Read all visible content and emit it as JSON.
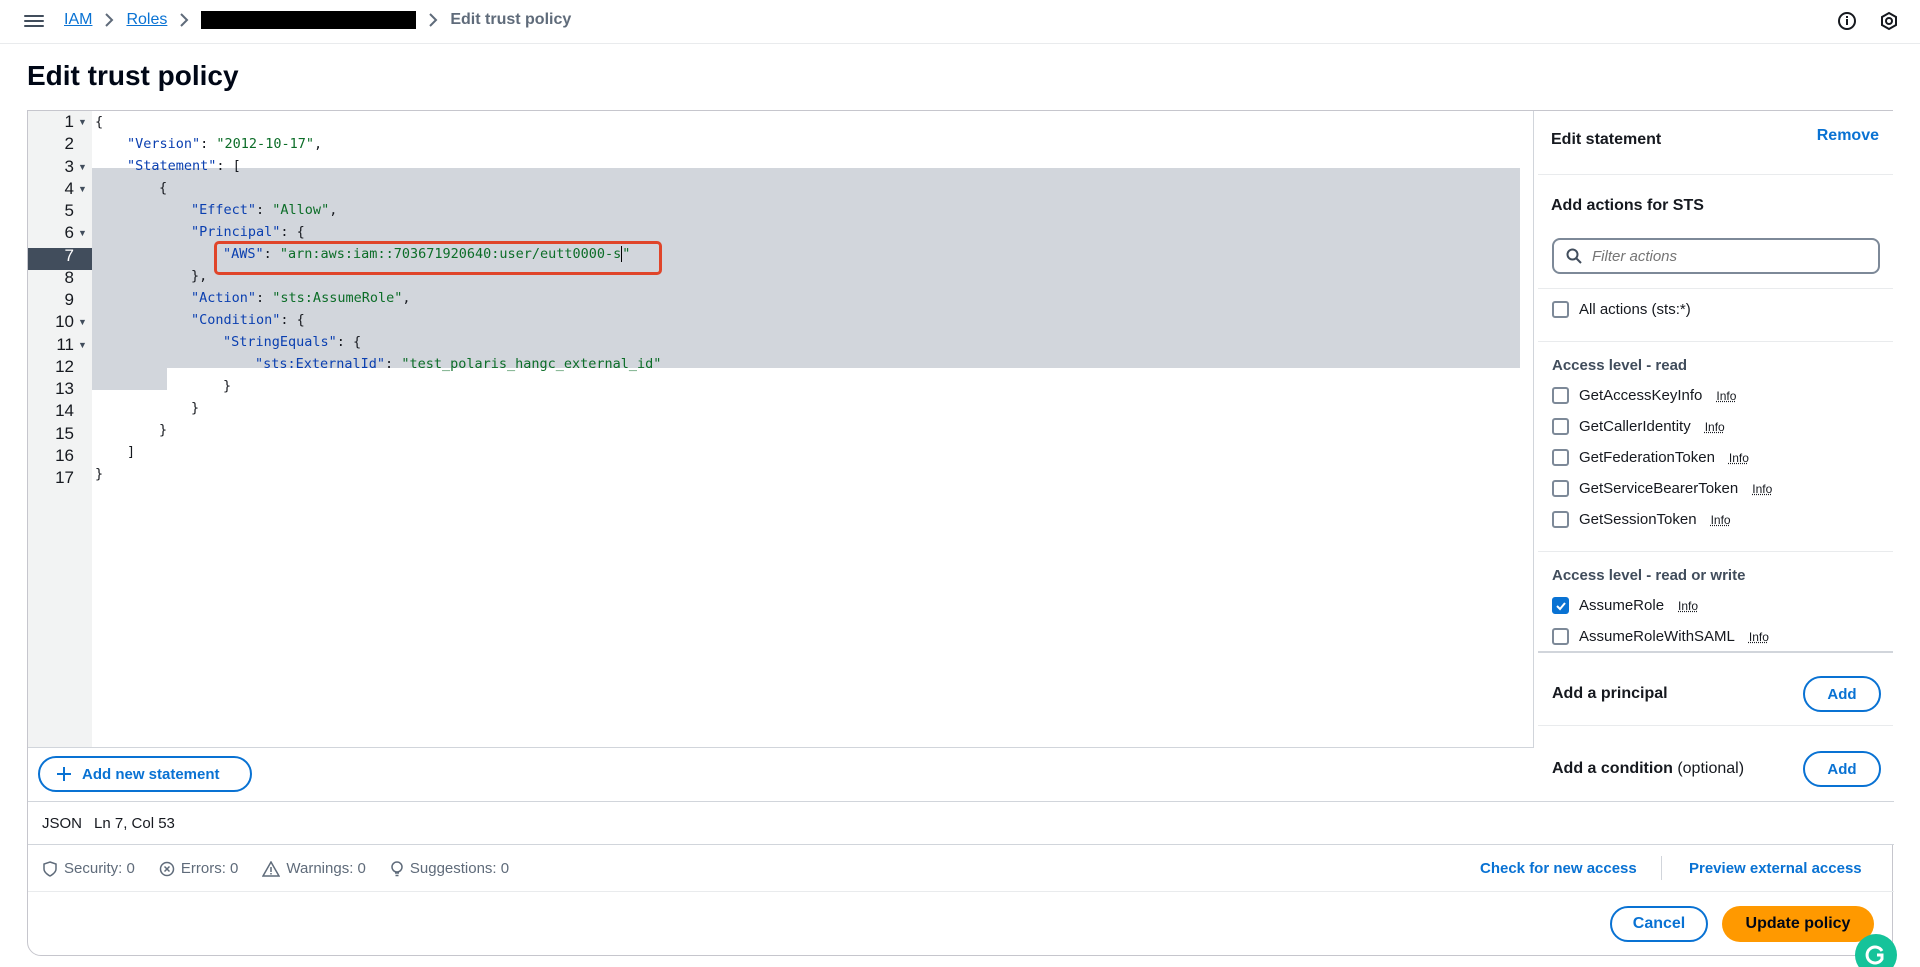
{
  "breadcrumb": {
    "iam": "IAM",
    "roles": "Roles",
    "current": "Edit trust policy"
  },
  "page": {
    "title": "Edit trust policy"
  },
  "editor": {
    "line_numbers": [
      "1",
      "2",
      "3",
      "4",
      "5",
      "6",
      "7",
      "8",
      "9",
      "10",
      "11",
      "12",
      "13",
      "14",
      "15",
      "16",
      "17"
    ],
    "add_statement_label": "Add new statement",
    "code": {
      "l1": "{",
      "l2_key": "\"Version\"",
      "l2_val": "\"2012-10-17\"",
      "l3_key": "\"Statement\"",
      "l3_rest": ": [",
      "l4": "{",
      "l5_key": "\"Effect\"",
      "l5_val": "\"Allow\"",
      "l6_key": "\"Principal\"",
      "l6_rest": ": {",
      "l7_key": "\"AWS\"",
      "l7_val_a": "\"arn:aws:iam::703671920640:user/eutt0000-s",
      "l7_val_b": "\"",
      "l8": "},",
      "l9_key": "\"Action\"",
      "l9_val": "\"sts:AssumeRole\"",
      "l10_key": "\"Condition\"",
      "l10_rest": ": {",
      "l11_key": "\"StringEquals\"",
      "l11_rest": ": {",
      "l12_key": "\"sts:ExternalId\"",
      "l12_val": "\"test_polaris_hangc_external_id\"",
      "l13": "}",
      "l14": "}",
      "l15": "}",
      "l16": "]",
      "l17": "}"
    }
  },
  "panel": {
    "title": "Edit statement",
    "remove_label": "Remove",
    "actions_title": "Add actions for STS",
    "filter_placeholder": "Filter actions",
    "all_actions": "All actions (sts:*)",
    "info_label": "Info",
    "read_section": "Access level - read",
    "read_actions": [
      "GetAccessKeyInfo",
      "GetCallerIdentity",
      "GetFederationToken",
      "GetServiceBearerToken",
      "GetSessionToken"
    ],
    "rw_section": "Access level - read or write",
    "rw_actions": [
      "AssumeRole",
      "AssumeRoleWithSAML"
    ],
    "rw_checked": [
      true,
      false
    ],
    "add_principal": "Add a principal",
    "add_condition": "Add a condition",
    "optional": "(optional)",
    "add_label": "Add"
  },
  "status": {
    "format": "JSON",
    "position": "Ln 7, Col 53"
  },
  "validation": {
    "security": "Security: 0",
    "errors": "Errors: 0",
    "warnings": "Warnings: 0",
    "suggestions": "Suggestions: 0",
    "check_new_access": "Check for new access",
    "preview_external": "Preview external access"
  },
  "footer": {
    "cancel": "Cancel",
    "update": "Update policy"
  },
  "colors": {
    "link": "#0972d3",
    "primary_button": "#ff9900",
    "highlight_box": "#e0452a"
  }
}
